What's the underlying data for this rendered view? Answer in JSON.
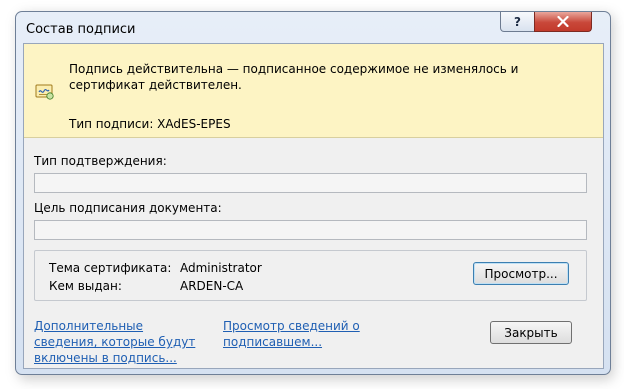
{
  "window": {
    "title": "Состав подписи",
    "help_label": "?",
    "close_label": "✕"
  },
  "banner": {
    "status_text": "Подпись действительна — подписанное содержимое не изменялось и сертификат действителен.",
    "signature_type": "Тип подписи: XAdES-EPES"
  },
  "fields": {
    "commitment_type_label": "Тип подтверждения:",
    "commitment_type_value": "",
    "purpose_label": "Цель подписания документа:",
    "purpose_value": ""
  },
  "certificate": {
    "subject_label": "Тема сертификата:",
    "subject_value": "Administrator",
    "issuer_label": "Кем выдан:",
    "issuer_value": "ARDEN-CA",
    "view_button": "Просмотр..."
  },
  "links": {
    "additional_info": "Дополнительные сведения, которые будут включены в подпись...",
    "signer_details": "Просмотр сведений о подписавшем..."
  },
  "buttons": {
    "close": "Закрыть"
  }
}
